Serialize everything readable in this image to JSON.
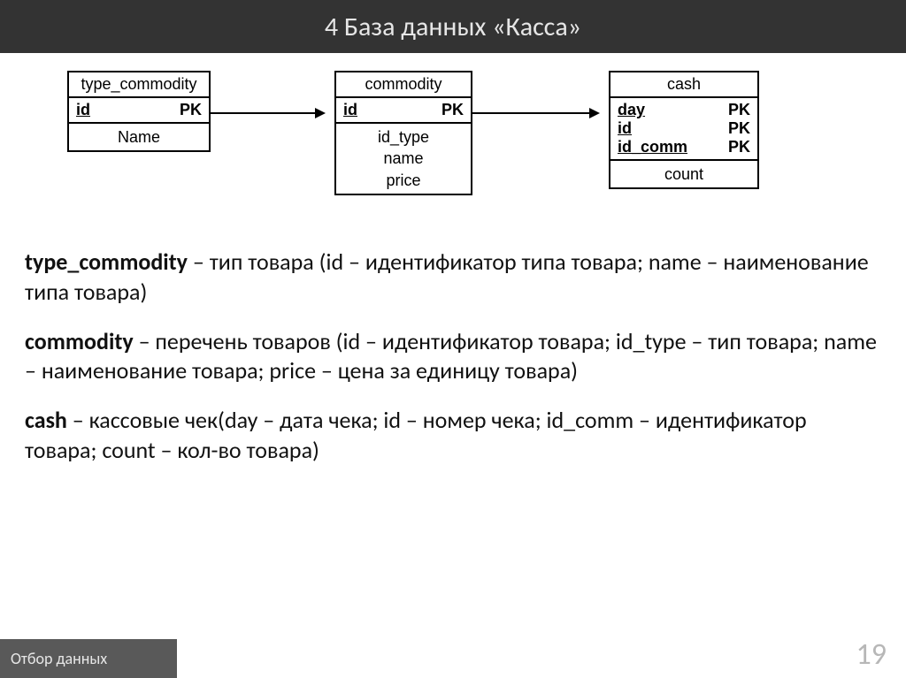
{
  "header": {
    "title": "4  База данных «Касса»"
  },
  "diagram": {
    "tables": {
      "type_commodity": {
        "name": "type_commodity",
        "keys": [
          {
            "field": "id",
            "tag": "PK"
          }
        ],
        "fields_block": "Name"
      },
      "commodity": {
        "name": "commodity",
        "keys": [
          {
            "field": "id",
            "tag": "PK"
          }
        ],
        "fields_block": "id_type\nname\nprice"
      },
      "cash": {
        "name": "cash",
        "keys": [
          {
            "field": "day",
            "tag": "PK"
          },
          {
            "field": "id",
            "tag": "PK"
          },
          {
            "field": "id_comm",
            "tag": "PK"
          }
        ],
        "fields_block": "count"
      }
    }
  },
  "descriptions": {
    "p1_bold": "type_commodity",
    "p1_rest": " – тип товара (id – идентификатор типа товара; name – наименование типа товара)",
    "p2_bold": "commodity",
    "p2_rest": " – перечень товаров (id – идентификатор товара; id_type – тип товара; name – наименование товара; price – цена за единицу товара)",
    "p3_bold": "cash",
    "p3_rest": " – кассовые чек(day – дата чека; id – номер чека; id_comm – идентификатор товара; count – кол-во товара)"
  },
  "footer": {
    "left": "Отбор данных",
    "page": "19"
  }
}
